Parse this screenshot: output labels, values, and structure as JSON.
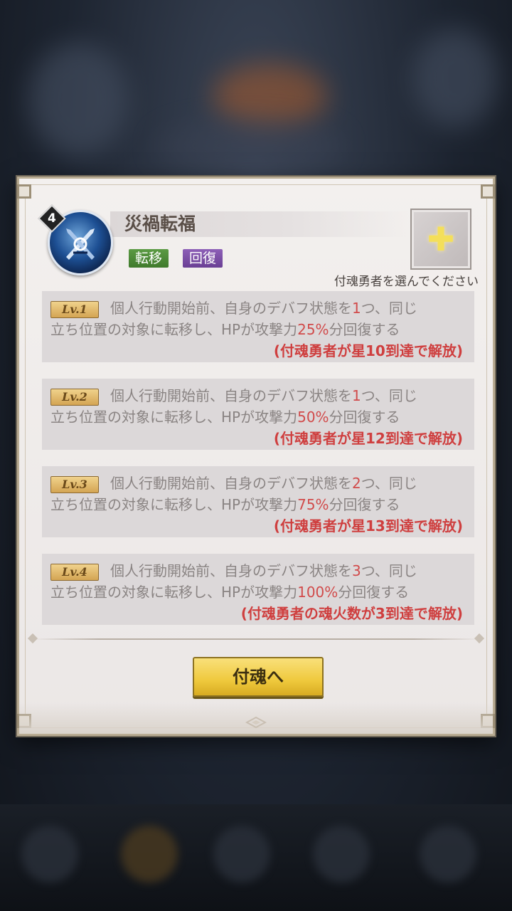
{
  "skill": {
    "rank": "4",
    "title": "災禍転福",
    "tags": [
      "転移",
      "回復"
    ],
    "slot_hint": "付魂勇者を選んでください"
  },
  "levels": [
    {
      "badge": "Lv.1",
      "pre": "個人行動開始前、自身のデバフ状態を",
      "count": "1",
      "post": "つ、同じ",
      "line2_pre": "立ち位置の対象に転移し、HPが攻撃力",
      "pct": "25%",
      "line2_post": "分回復する",
      "unlock": "(付魂勇者が星10到達で解放)"
    },
    {
      "badge": "Lv.2",
      "pre": "個人行動開始前、自身のデバフ状態を",
      "count": "1",
      "post": "つ、同じ",
      "line2_pre": "立ち位置の対象に転移し、HPが攻撃力",
      "pct": "50%",
      "line2_post": "分回復する",
      "unlock": "(付魂勇者が星12到達で解放)"
    },
    {
      "badge": "Lv.3",
      "pre": "個人行動開始前、自身のデバフ状態を",
      "count": "2",
      "post": "つ、同じ",
      "line2_pre": "立ち位置の対象に転移し、HPが攻撃力",
      "pct": "75%",
      "line2_post": "分回復する",
      "unlock": "(付魂勇者が星13到達で解放)"
    },
    {
      "badge": "Lv.4",
      "pre": "個人行動開始前、自身のデバフ状態を",
      "count": "3",
      "post": "つ、同じ",
      "line2_pre": "立ち位置の対象に転移し、HPが攻撃力",
      "pct": "100%",
      "line2_post": "分回復する",
      "unlock": "(付魂勇者の魂火数が3到達で解放)"
    }
  ],
  "button": {
    "label": "付魂へ"
  },
  "icons": {
    "skill": "crossed-blades-icon",
    "slot": "plus-icon"
  },
  "colors": {
    "accent_red": "#cf3f3f",
    "tag_green": "#4f8a38",
    "tag_purple": "#7a4ea4",
    "button_gold": "#efc93d"
  }
}
